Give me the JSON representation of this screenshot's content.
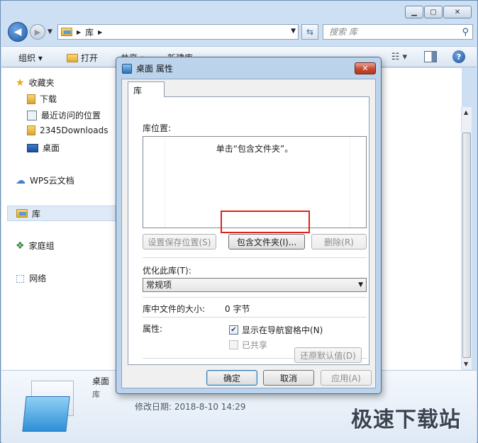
{
  "explorer": {
    "address_crumb": "库",
    "search_placeholder": "搜索 库",
    "toolbar": {
      "organize": "组织 ▾",
      "open": "打开",
      "share": "共享 ▾",
      "new_lib": "新建库"
    },
    "nav": {
      "favorites": "收藏夹",
      "downloads": "下载",
      "recent": "最近访问的位置",
      "downloads2345": "2345Downloads",
      "desktop": "桌面",
      "wps": "WPS云文档",
      "libraries": "库",
      "homegroup": "家庭组",
      "network": "网络"
    },
    "details": {
      "name": "桌面",
      "type": "库",
      "modified": "修改日期: 2018-8-10 14:29"
    },
    "watermark": "极速下载站"
  },
  "dialog": {
    "title": "桌面 属性",
    "tab": "库",
    "library_locations_label": "库位置:",
    "empty_hint": "单击“包含文件夹”。",
    "set_save_location": "设置保存位置(S)",
    "include_folder": "包含文件夹(I)...",
    "remove": "删除(R)",
    "optimize_label": "优化此库(T):",
    "optimize_value": "常规项",
    "size_label": "库中文件的大小:",
    "size_value": "0 字节",
    "attributes_label": "属性:",
    "show_in_nav": "显示在导航窗格中(N)",
    "shared": "已共享",
    "restore_defaults": "还原默认值(D)",
    "ok": "确定",
    "cancel": "取消",
    "apply": "应用(A)"
  },
  "colors": {
    "highlight_border": "#e0221b",
    "dialog_frame": "#bcd3ec",
    "close_button": "#c64a31"
  }
}
